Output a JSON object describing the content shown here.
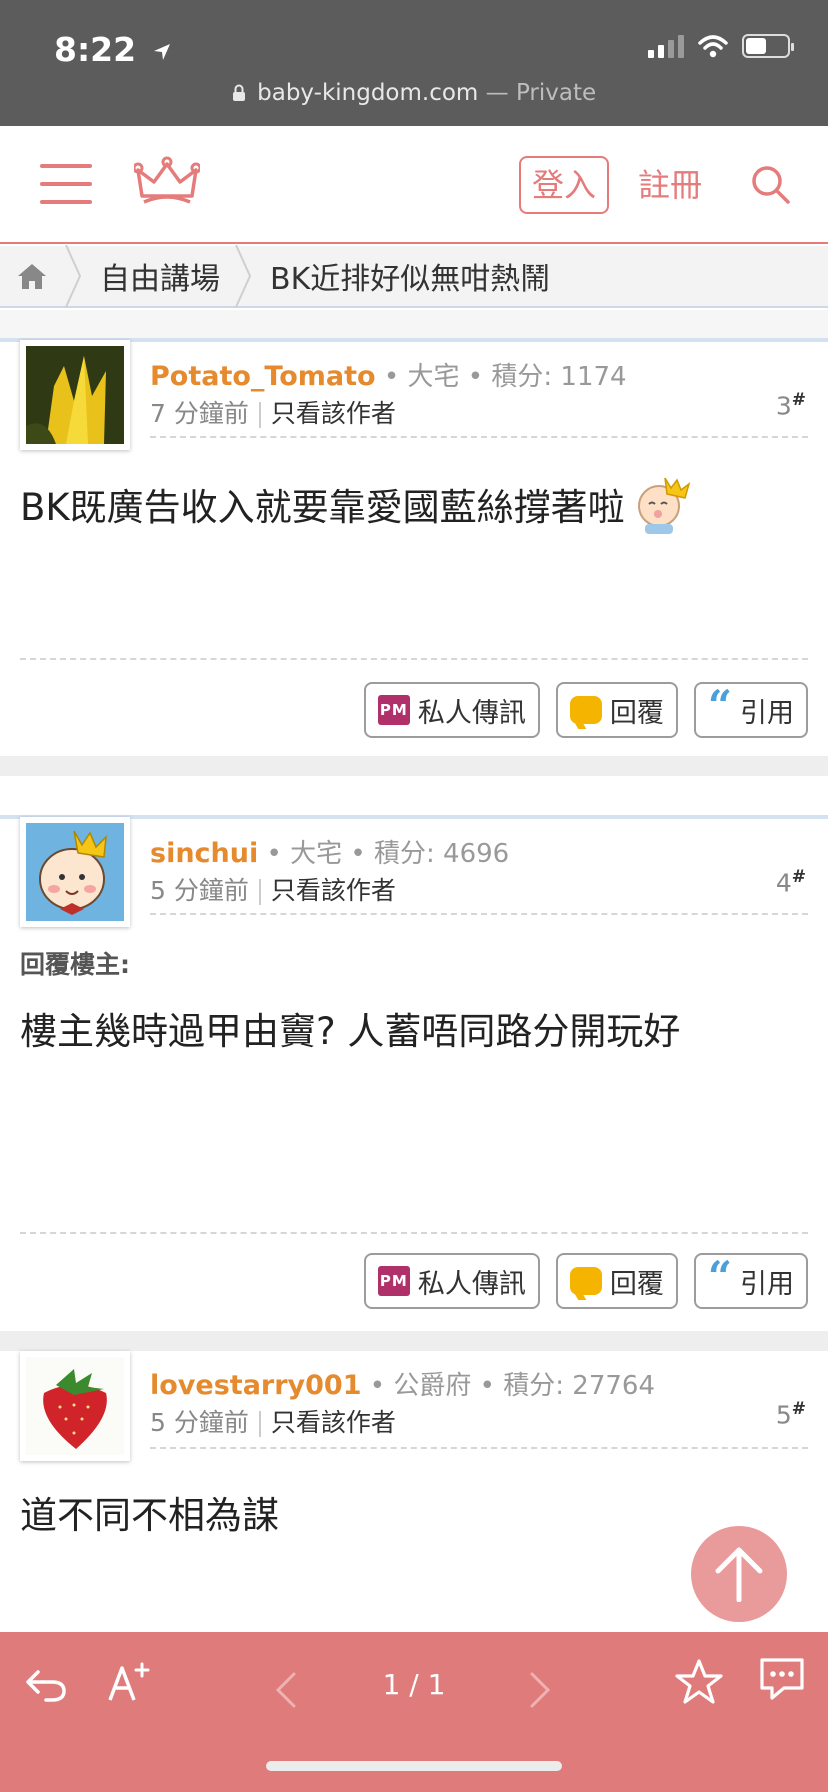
{
  "status": {
    "time": "8:22",
    "url": "baby-kingdom.com",
    "private_label": "— Private"
  },
  "header": {
    "login": "登入",
    "register": "註冊"
  },
  "breadcrumb": {
    "section": "自由講場",
    "thread": "BK近排好似無咁熱鬧"
  },
  "posts": [
    {
      "author": "Potato_Tomato",
      "rank": "大宅",
      "points_label": "積分: 1174",
      "time": "7 分鐘前",
      "only_author": "只看該作者",
      "floor": "3",
      "floor_mark": "#",
      "reply_to": "",
      "content": "BK既廣告收入就要靠愛國藍絲撐著啦"
    },
    {
      "author": "sinchui",
      "rank": "大宅",
      "points_label": "積分: 4696",
      "time": "5 分鐘前",
      "only_author": "只看該作者",
      "floor": "4",
      "floor_mark": "#",
      "reply_to": "回覆樓主:",
      "content": "樓主幾時過甲由竇? 人蓄唔同路分開玩好"
    },
    {
      "author": "lovestarry001",
      "rank": "公爵府",
      "points_label": "積分: 27764",
      "time": "5 分鐘前",
      "only_author": "只看該作者",
      "floor": "5",
      "floor_mark": "#",
      "reply_to": "",
      "content": "道不同不相為謀"
    }
  ],
  "actions": {
    "pm": "私人傳訊",
    "pm_icon": "PM",
    "reply": "回覆",
    "quote": "引用"
  },
  "bottombar": {
    "pager": "1 / 1"
  },
  "colors": {
    "brand": "#e57b7b",
    "bottombar": "#e07b7b",
    "author": "#e68a2e"
  }
}
